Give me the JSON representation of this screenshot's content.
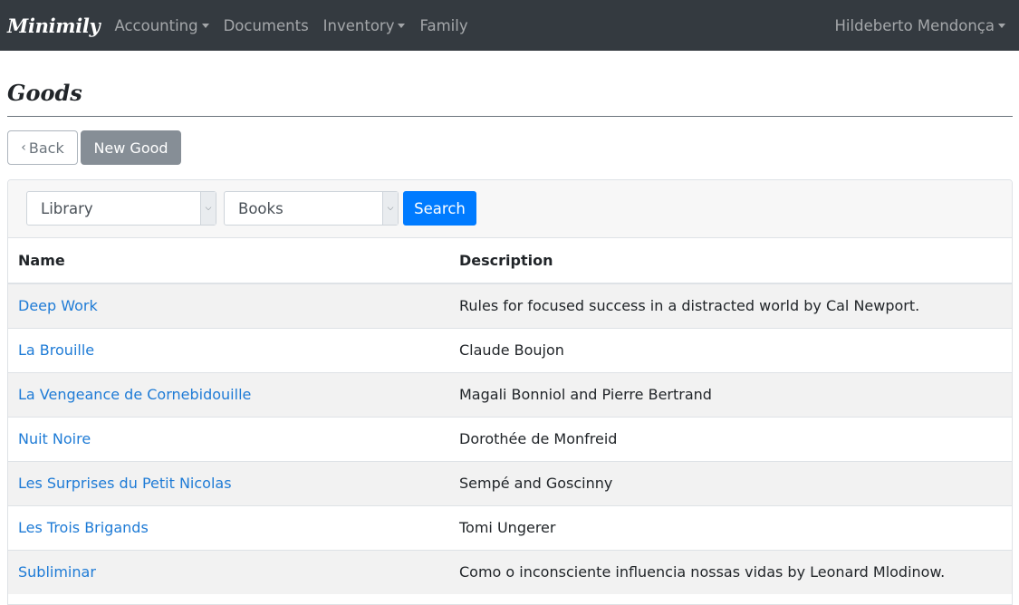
{
  "navbar": {
    "brand": "Minimily",
    "items": [
      {
        "label": "Accounting",
        "dropdown": true
      },
      {
        "label": "Documents",
        "dropdown": false
      },
      {
        "label": "Inventory",
        "dropdown": true
      },
      {
        "label": "Family",
        "dropdown": false
      }
    ],
    "user": "Hildeberto Mendonça"
  },
  "page": {
    "title": "Goods",
    "back_label": "Back",
    "new_label": "New Good"
  },
  "filters": {
    "library_selected": "Library",
    "category_selected": "Books",
    "search_label": "Search"
  },
  "table": {
    "headers": {
      "name": "Name",
      "description": "Description"
    },
    "rows": [
      {
        "name": "Deep Work",
        "description": "Rules for focused success in a distracted world by Cal Newport."
      },
      {
        "name": "La Brouille",
        "description": "Claude Boujon"
      },
      {
        "name": "La Vengeance de Cornebidouille",
        "description": "Magali Bonniol and Pierre Bertrand"
      },
      {
        "name": "Nuit Noire",
        "description": "Dorothée de Monfreid"
      },
      {
        "name": "Les Surprises du Petit Nicolas",
        "description": "Sempé and Goscinny"
      },
      {
        "name": "Les Trois Brigands",
        "description": "Tomi Ungerer"
      },
      {
        "name": "Subliminar",
        "description": "Como o inconsciente influencia nossas vidas by Leonard Mlodinow."
      }
    ]
  },
  "colors": {
    "navbar_bg": "#343a40",
    "primary": "#007bff",
    "link": "#1e7bd6"
  }
}
